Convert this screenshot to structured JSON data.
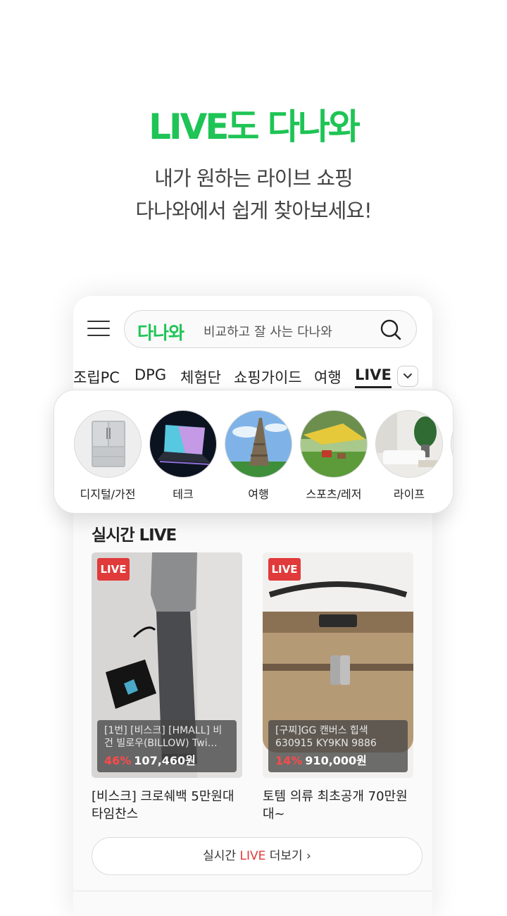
{
  "headline": "LIVE도 다나와",
  "subtitle": [
    "내가 원하는 라이브 쇼핑",
    "다나와에서 쉽게 찾아보세요!"
  ],
  "header": {
    "brand": "다나와",
    "search_placeholder": "비교하고 잘 사는 다나와",
    "menu_icon": "hamburger-menu-icon",
    "search_icon": "search-icon"
  },
  "tabs": [
    "조립PC",
    "DPG",
    "체험단",
    "쇼핑가이드",
    "여행",
    "LIVE"
  ],
  "active_tab": "LIVE",
  "categories": [
    {
      "label": "디지털/가전"
    },
    {
      "label": "테크"
    },
    {
      "label": "여행"
    },
    {
      "label": "스포츠/레저"
    },
    {
      "label": "라이프"
    }
  ],
  "live_section": {
    "title": "실시간 LIVE",
    "cards": [
      {
        "badge": "LIVE",
        "product": "[1번] [비스크] [HMALL] 비건 빌로우(BILLOW) Twi…",
        "discount": "46%",
        "price": "107,460원",
        "caption": "[비스크] 크로쉐백 5만원대 타임찬스"
      },
      {
        "badge": "LIVE",
        "product": "[구찌]GG 캔버스 힙색 630915 KY9KN 9886",
        "discount": "14%",
        "price": "910,000원",
        "caption": "토템 의류 최초공개 70만원대~"
      }
    ],
    "more_prefix": "실시간 ",
    "more_live": "LIVE",
    "more_suffix": " 더보기 ›"
  },
  "colors": {
    "brand_green": "#1ec455",
    "live_red": "#e03a3a"
  }
}
